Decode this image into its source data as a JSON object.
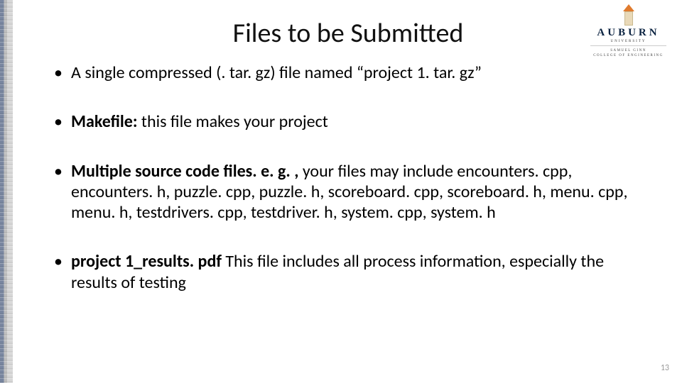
{
  "logo": {
    "name": "AUBURN",
    "sub": "UNIVERSITY",
    "college_line1": "SAMUEL GINN",
    "college_line2": "COLLEGE OF ENGINEERING"
  },
  "title": "Files to be Submitted",
  "bullets": {
    "b1": "A single compressed (. tar. gz) file named “project 1. tar. gz”",
    "b2_bold": "Makefile:",
    "b2_rest": " this file makes your project",
    "b3_bold": "Multiple source code files. e. g. ,",
    "b3_rest": " your files may include encounters. cpp, encounters. h, puzzle. cpp, puzzle. h, scoreboard. cpp, scoreboard. h, menu. cpp, menu. h, testdrivers. cpp,  testdriver. h, system. cpp, system. h",
    "b4_bold": "project 1_results. pdf",
    "b4_rest": " This file includes all process information, especially the results of testing"
  },
  "page_number": "13"
}
